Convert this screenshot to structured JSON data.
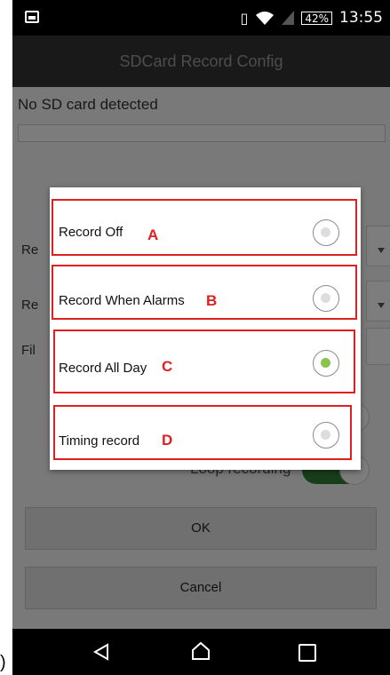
{
  "status_bar": {
    "battery": "42%",
    "time": "13:55"
  },
  "app": {
    "title": "SDCard Record Config"
  },
  "content": {
    "sd_status": "No SD card detected",
    "partial_labels": [
      "Re",
      "Re",
      "Fil"
    ],
    "loop_recording": "Loop recording"
  },
  "buttons": {
    "ok": "OK",
    "cancel": "Cancel"
  },
  "dialog": {
    "options": [
      {
        "label": "Record Off",
        "letter": "A",
        "selected": false
      },
      {
        "label": "Record When Alarms",
        "letter": "B",
        "selected": false
      },
      {
        "label": "Record All Day",
        "letter": "C",
        "selected": true
      },
      {
        "label": "Timing record",
        "letter": "D",
        "selected": false
      }
    ]
  },
  "colors": {
    "highlight": "#e02020",
    "radio_selected": "#8bc34a",
    "toggle_on": "#2e7d32"
  },
  "left_margin_text": ")"
}
